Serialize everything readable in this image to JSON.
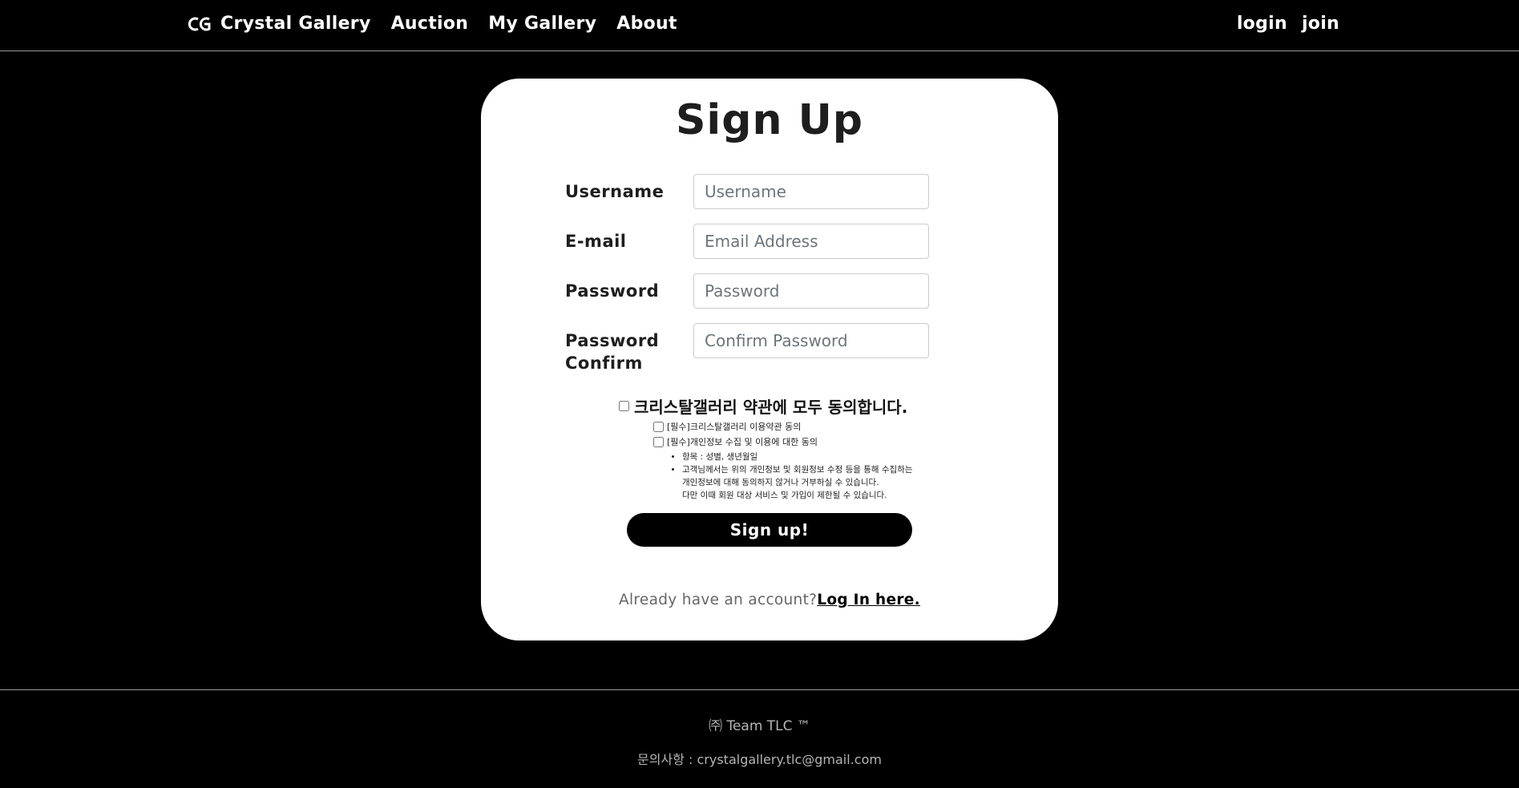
{
  "navbar": {
    "brand": "Crystal Gallery",
    "links": [
      "Auction",
      "My Gallery",
      "About"
    ],
    "login": "login",
    "join": "join"
  },
  "form": {
    "title": "Sign Up",
    "fields": [
      {
        "label": "Username",
        "placeholder": "Username"
      },
      {
        "label": "E-mail",
        "placeholder": "Email Address"
      },
      {
        "label": "Password",
        "placeholder": "Password"
      },
      {
        "label_line1": "Password",
        "label_line2": "Confirm",
        "placeholder": "Confirm Password"
      }
    ],
    "agree_all": "크리스탈갤러리 약관에 모두 동의합니다.",
    "agree_terms": "[필수]크리스탈갤러리 이용약관 동의",
    "agree_privacy": "[필수]개인정보 수집 및 이용에 대한 동의",
    "privacy_items": "항목 : 성별, 생년월일",
    "privacy_notice_1": "고객님께서는 위의 개인정보 및 회원정보 수정 등을 통해 수집하는",
    "privacy_notice_2": "개인정보에 대해 동의하지 않거나 거부하실 수 있습니다.",
    "privacy_notice_3": "다만 이때 회원 대상 서비스 및 가입이 제한될 수 있습니다.",
    "submit": "Sign up!",
    "login_prompt": "Already have an account?",
    "login_link": "Log In here."
  },
  "footer": {
    "team": "㈜ Team TLC ™",
    "contact": "문의사항 : crystalgallery.tlc@gmail.com"
  }
}
